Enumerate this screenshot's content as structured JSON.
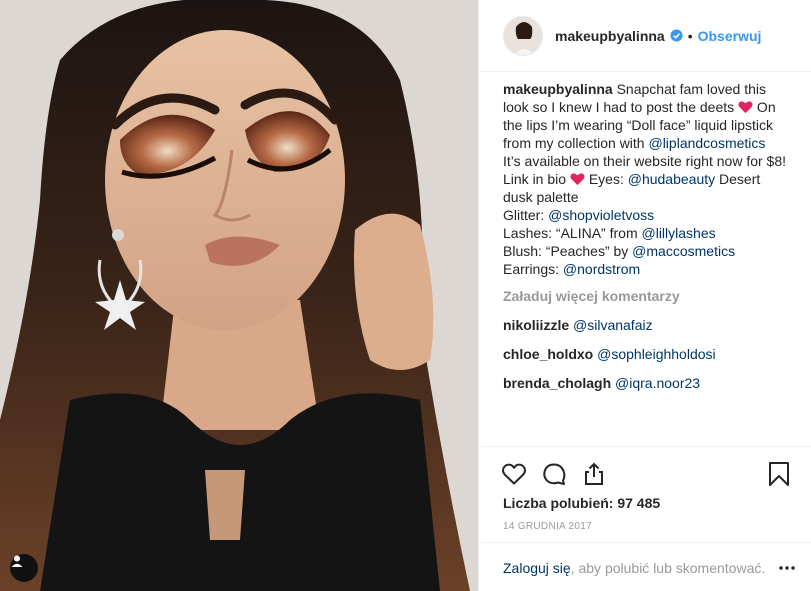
{
  "post": {
    "photo_label": "makeup portrait photo"
  },
  "header": {
    "username": "makeupbyalinna",
    "separator": "•",
    "follow_label": "Obserwuj"
  },
  "caption": {
    "author": "makeupbyalinna",
    "lines": [
      " Snapchat fam loved this",
      "look so I knew I had to post the deets ",
      " On",
      "the lips I’m wearing “Doll face” liquid lipstick",
      "from my collection with ",
      "@liplandcosmetics",
      "It’s available on their website right now for $8!",
      "Link in bio ",
      " Eyes: ",
      "@hudabeauty",
      " Desert",
      "dusk palette",
      "Glitter: ",
      "@shopvioletvoss",
      "Lashes: “ALINA” from ",
      "@lillylashes",
      "Blush: “Peaches” by ",
      "@maccosmetics",
      "Earrings: ",
      "@nordstrom"
    ]
  },
  "load_more_label": "Załaduj więcej komentarzy",
  "comments": [
    {
      "user": "nikoliizzle",
      "mention": "@silvanafaiz"
    },
    {
      "user": "chloe_holdxo",
      "mention": "@sophleighholdosi"
    },
    {
      "user": "brenda_cholagh",
      "mention": "@iqra.noor23"
    }
  ],
  "likes_label": "Liczba polubień: 97 485",
  "date_label": "14 GRUDNIA 2017",
  "login": {
    "link": "Zaloguj się",
    "rest": ", aby polubić lub skomentować."
  },
  "colors": {
    "accent": "#3897f0",
    "mention": "#003569",
    "muted": "#999999",
    "heart": "#e0245e"
  },
  "icons": [
    "heart-icon",
    "comment-icon",
    "share-icon",
    "bookmark-icon",
    "more-icon",
    "user-tag-icon",
    "verified-icon"
  ]
}
